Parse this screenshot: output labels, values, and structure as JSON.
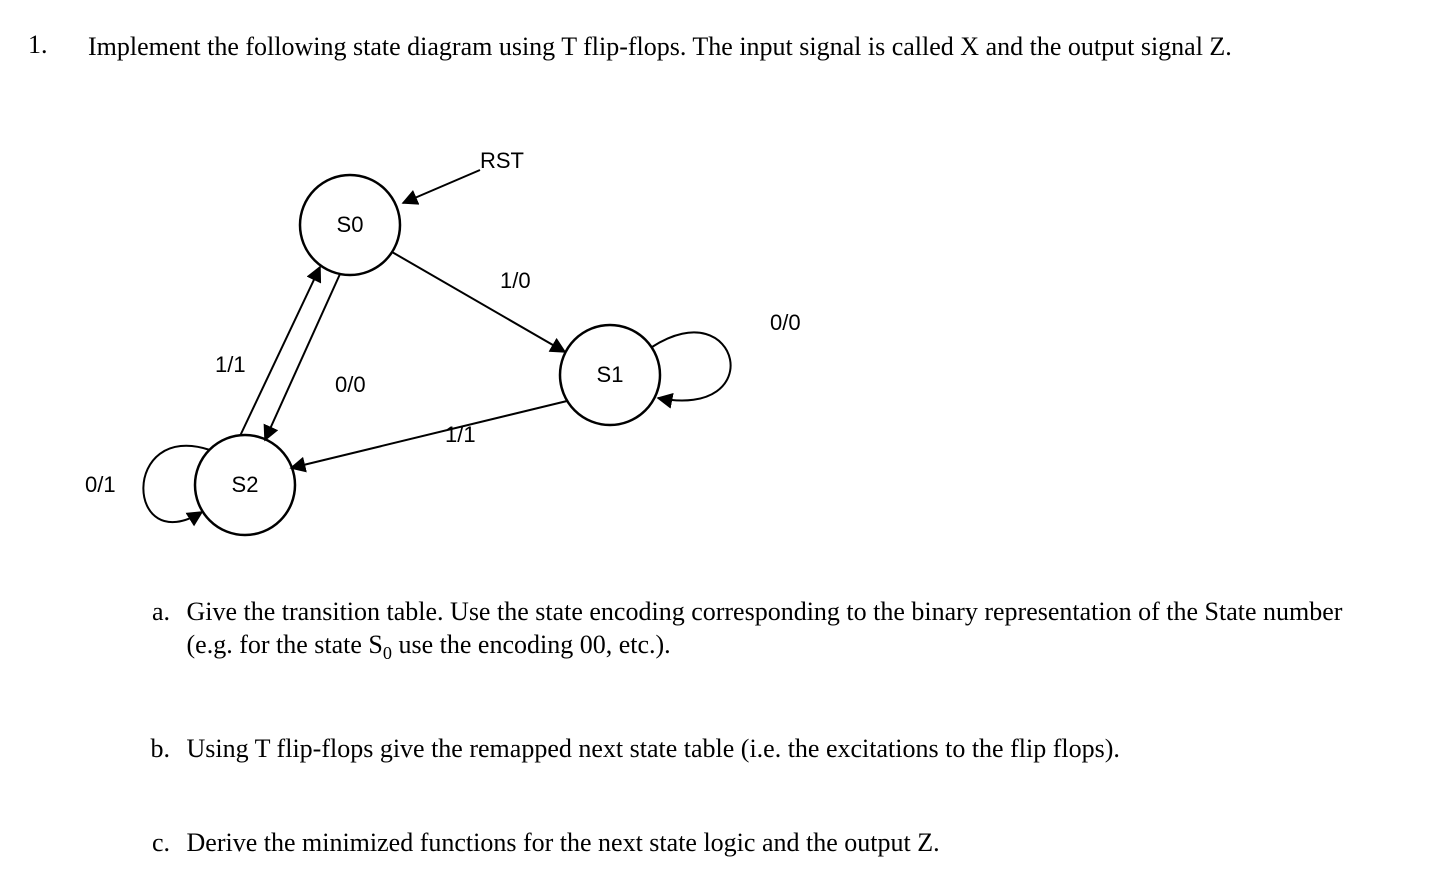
{
  "problem": {
    "number": "1.",
    "intro": "Implement the following state diagram using T flip-flops. The input signal is called X and the output signal Z.",
    "diagram": {
      "labels": {
        "rst": "RST",
        "s0": "S0",
        "s1": "S1",
        "s2": "S2",
        "edge_s0_s1": "1/0",
        "edge_s0_s2": "0/0",
        "edge_s1_s1": "0/0",
        "edge_s1_s2": "1/1",
        "edge_s2_s0": "1/1",
        "edge_s2_s2": "0/1"
      }
    },
    "parts": {
      "a": {
        "label": "a.",
        "text_prefix": "Give the transition table. Use the state encoding corresponding to the binary representation of the State number (e.g. for the state S",
        "sub": "0",
        "text_suffix": " use the encoding 00, etc.)."
      },
      "b": {
        "label": "b.",
        "text": "Using T flip-flops give the remapped next state table (i.e. the excitations to the flip flops)."
      },
      "c": {
        "label": "c.",
        "text": "Derive the minimized functions for the next state logic and the output Z."
      }
    }
  },
  "chart_data": {
    "type": "state_diagram",
    "initial_state": "S0",
    "states": [
      "S0",
      "S1",
      "S2"
    ],
    "transitions": [
      {
        "from": "S0",
        "to": "S1",
        "input": 1,
        "output": 0
      },
      {
        "from": "S0",
        "to": "S2",
        "input": 0,
        "output": 0
      },
      {
        "from": "S1",
        "to": "S1",
        "input": 0,
        "output": 0
      },
      {
        "from": "S1",
        "to": "S2",
        "input": 1,
        "output": 1
      },
      {
        "from": "S2",
        "to": "S0",
        "input": 1,
        "output": 1
      },
      {
        "from": "S2",
        "to": "S2",
        "input": 0,
        "output": 1
      }
    ]
  }
}
